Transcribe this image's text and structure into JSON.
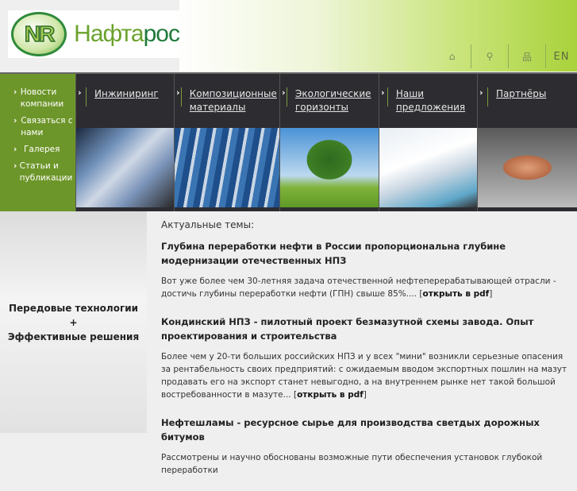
{
  "brand": {
    "logo_mark": "NR",
    "name_part1": "Нафта",
    "name_part2": "рос"
  },
  "tools": {
    "home": "⌂",
    "search": "⚲",
    "sitemap": "品",
    "lang": "EN"
  },
  "sidebar": {
    "items": [
      {
        "label": "Новости компании"
      },
      {
        "label": "Связаться с нами"
      },
      {
        "label": "Галерея"
      },
      {
        "label": "Статьи и публикации"
      }
    ]
  },
  "nav": {
    "items": [
      {
        "label": "Инжиниринг"
      },
      {
        "label": "Композиционные материалы"
      },
      {
        "label": "Экологические горизонты"
      },
      {
        "label": "Наши предложения"
      },
      {
        "label": "Партнёры"
      }
    ]
  },
  "slogan": {
    "line1": "Передовые технологии",
    "line2": "+",
    "line3": "Эффективные решения"
  },
  "content": {
    "heading": "Актуальные темы:",
    "articles": [
      {
        "title": "Глубина переработки нефти в России пропорциональна глубине модернизации отечественных НПЗ",
        "text": "Вот уже более чем 30-летняя задача отечественной нефтеперерабатывающей отрасли - достичь глубины переработки нефти (ГПН) свыше 85%.... ",
        "link": "открыть в pdf"
      },
      {
        "title": "Кондинский НПЗ - пилотный проект безмазутной схемы завода. Опыт проектирования и строительства",
        "text": "Более чем у 20-ти больших российских НПЗ и у всех \"мини\" возникли серьезные опасения за рентабельность своих предприятий: с ожидаемым вводом экспортных пошлин на мазут продавать его на экспорт станет невыгодно, а на внутреннем рынке нет такой большой востребованности в мазуте... ",
        "link": "открыть в pdf"
      },
      {
        "title": "Нефтешламы - ресурсное сырье для производства светдых дорожных битумов",
        "text": "Рассмотрены и научно обоснованы возможные пути обеспечения установок глубокой переработки",
        "link": ""
      }
    ]
  },
  "colors": {
    "green": "#6d962a",
    "dark": "#2d2c30"
  }
}
